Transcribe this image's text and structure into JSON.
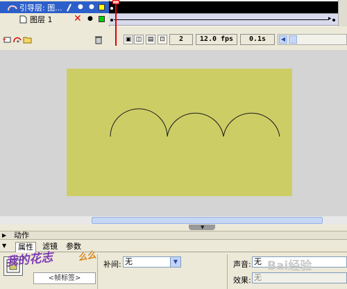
{
  "timeline": {
    "layers": [
      {
        "name": "引导层: 图...",
        "icon": "guide-layer-icon",
        "color": "#ffff00",
        "selected": true
      },
      {
        "name": "图层 1",
        "icon": "layer-icon",
        "color": "#00cc00",
        "selected": false
      }
    ],
    "toolbar": {
      "current_frame": "2",
      "frame_rate": "12.0 fps",
      "elapsed_time": "0.1s"
    }
  },
  "stage": {
    "background_color": "#cdcd66",
    "workspace_color": "#d4d4d4"
  },
  "panels": {
    "actions_title": "动作",
    "tabs": [
      "属性",
      "滤镜",
      "参数"
    ],
    "active_tab": "属性",
    "properties": {
      "frame_label_placeholder": "<帧标签>",
      "tween_label": "补间:",
      "tween_value": "无",
      "sound_label": "声音:",
      "sound_value": "无",
      "effect_label": "效果:",
      "effect_value": "无"
    }
  },
  "overlays": {
    "watermark_text": "我的花志",
    "watermark_text_2": "么么",
    "baidu_watermark": "Bai经验"
  }
}
